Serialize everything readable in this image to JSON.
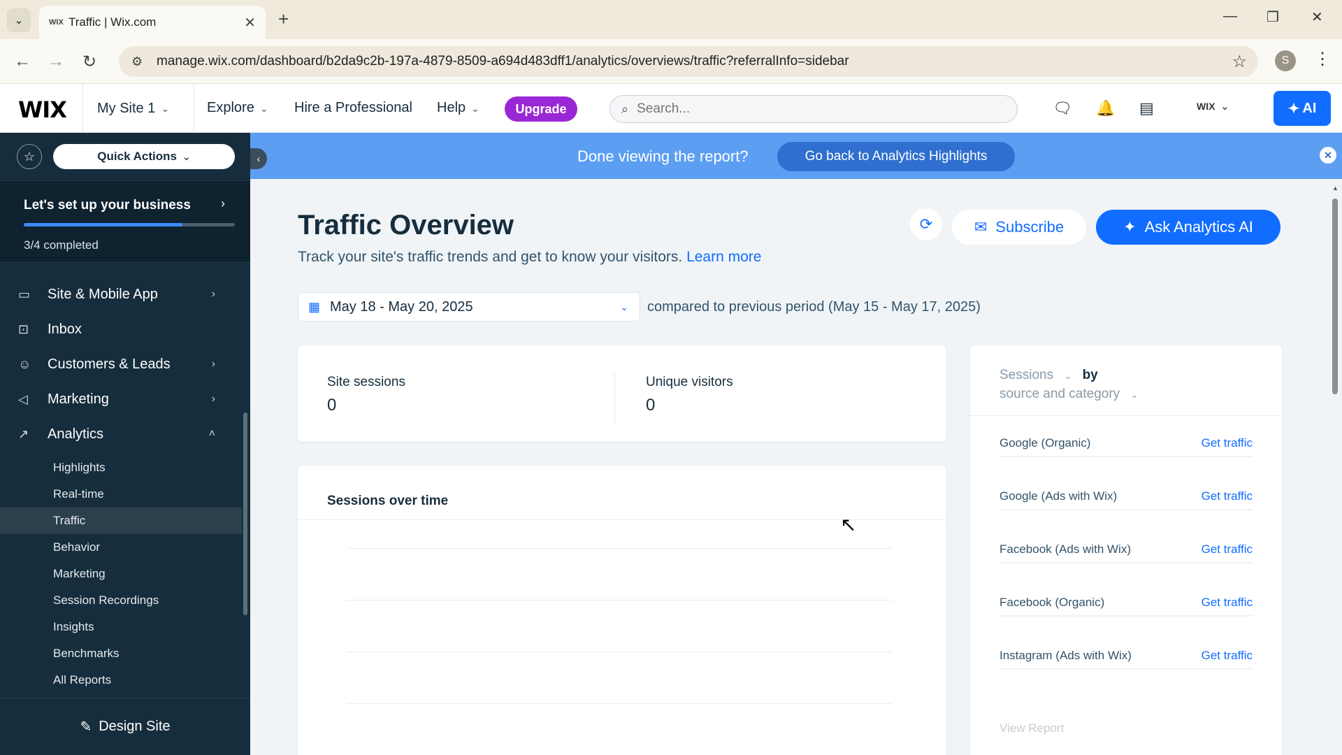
{
  "browser": {
    "tab_title": "Traffic | Wix.com",
    "tab_favicon": "WIX",
    "url": "manage.wix.com/dashboard/b2da9c2b-197a-4879-8509-a694d483dff1/analytics/overviews/traffic?referralInfo=sidebar",
    "profile_initial": "S"
  },
  "header": {
    "logo": "WIX",
    "site_name": "My Site 1",
    "explore": "Explore",
    "hire": "Hire a Professional",
    "help": "Help",
    "upgrade": "Upgrade",
    "search_placeholder": "Search...",
    "account_label": "WIX",
    "ai_label": "AI"
  },
  "sidebar": {
    "quick_actions": "Quick Actions",
    "setup_title": "Let's set up your business",
    "setup_progress_text": "3/4 completed",
    "setup_progress_fraction": 0.75,
    "items": [
      {
        "label": "Site & Mobile App",
        "icon": "site-icon"
      },
      {
        "label": "Inbox",
        "icon": "inbox-icon"
      },
      {
        "label": "Customers & Leads",
        "icon": "customers-icon"
      },
      {
        "label": "Marketing",
        "icon": "megaphone-icon"
      },
      {
        "label": "Analytics",
        "icon": "analytics-icon"
      }
    ],
    "analytics_sub": [
      "Highlights",
      "Real-time",
      "Traffic",
      "Behavior",
      "Marketing",
      "Session Recordings",
      "Insights",
      "Benchmarks",
      "All Reports"
    ],
    "design_site": "Design Site"
  },
  "banner": {
    "message": "Done viewing the report?",
    "button": "Go back to Analytics Highlights"
  },
  "main": {
    "title": "Traffic Overview",
    "subtitle": "Track your site's traffic trends and get to know your visitors.",
    "learn_more": "Learn more",
    "subscribe": "Subscribe",
    "ask_ai": "Ask Analytics AI",
    "date_range": "May 18 - May 20, 2025",
    "compared": "compared to previous period (May 15 - May 17, 2025)",
    "kpis": [
      {
        "label": "Site sessions",
        "value": "0"
      },
      {
        "label": "Unique visitors",
        "value": "0"
      }
    ],
    "chart_title": "Sessions over time",
    "sources": {
      "metric": "Sessions",
      "by": "by",
      "dimension": "source and category",
      "rows": [
        {
          "label": "Google (Organic)",
          "link": "Get traffic"
        },
        {
          "label": "Google (Ads with Wix)",
          "link": "Get traffic"
        },
        {
          "label": "Facebook (Ads with Wix)",
          "link": "Get traffic"
        },
        {
          "label": "Facebook (Organic)",
          "link": "Get traffic"
        },
        {
          "label": "Instagram (Ads with Wix)",
          "link": "Get traffic"
        }
      ],
      "view_report": "View Report"
    }
  },
  "colors": {
    "accent": "#116dff",
    "sidebar_bg": "#162d3d",
    "upgrade": "#9a27d5",
    "banner": "#5c9ef2"
  }
}
